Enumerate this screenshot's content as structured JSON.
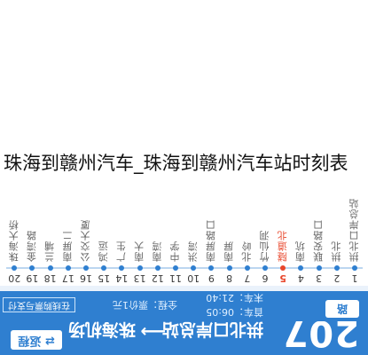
{
  "header": {
    "route_number": "207",
    "from_stop": "拱北口岸总站",
    "arrow": "⟶",
    "to_stop": "珠海机场",
    "reverse_label": "⇄ 返程",
    "direction_tag": "路"
  },
  "subheader": {
    "first_bus": "首车：06:05",
    "last_bus": "末车：21:40",
    "fare": "全程：票价1元",
    "ticket_button": "在线购票与支付"
  },
  "stops": [
    {
      "num": "1",
      "name": "拱北口岸总站"
    },
    {
      "num": "2",
      "name": "拱北"
    },
    {
      "num": "3",
      "name": "联安路口"
    },
    {
      "num": "4",
      "name": "南坑"
    },
    {
      "num": "5",
      "name": "隧道北",
      "current": true
    },
    {
      "num": "6",
      "name": "竹仙洞"
    },
    {
      "num": "7",
      "name": "北岭"
    },
    {
      "num": "8",
      "name": "南屏"
    },
    {
      "num": "9",
      "name": "南屏路口"
    },
    {
      "num": "10",
      "name": "洪湾"
    },
    {
      "num": "11",
      "name": "中学"
    },
    {
      "num": "12",
      "name": "南湾"
    },
    {
      "num": "13",
      "name": "南大"
    },
    {
      "num": "14",
      "name": "广生"
    },
    {
      "num": "15",
      "name": "鸿运"
    },
    {
      "num": "16",
      "name": "公交大厦"
    },
    {
      "num": "17",
      "name": "南屏二"
    },
    {
      "num": "18",
      "name": "兰埔"
    },
    {
      "num": "19",
      "name": "金湾路"
    },
    {
      "num": "20",
      "name": "珠海大桥"
    }
  ],
  "caption": "珠海到赣州汽车_珠海到赣州汽车站时刻表",
  "colors": {
    "header_bg": "#2f7fd0",
    "current_stop": "#e8462b"
  }
}
